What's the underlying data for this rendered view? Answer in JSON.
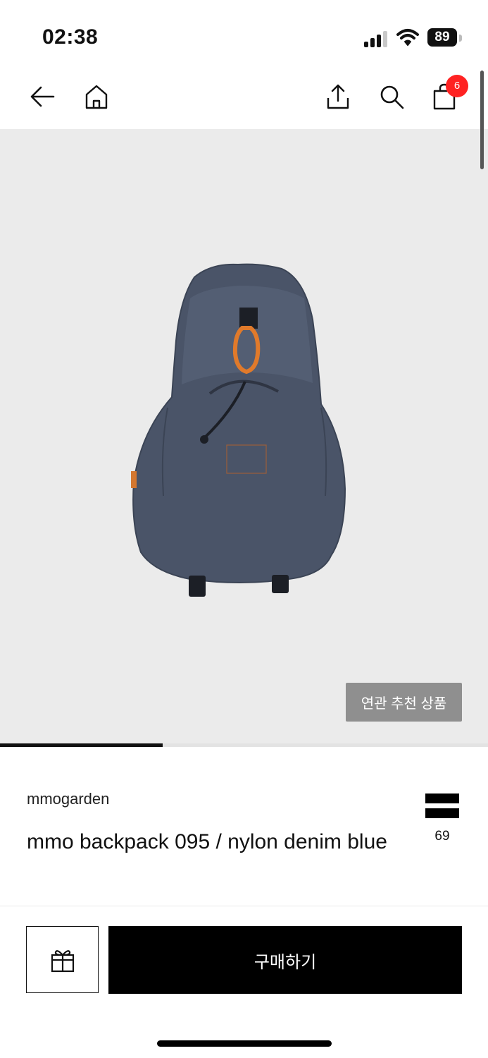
{
  "status_bar": {
    "time": "02:38",
    "battery": "89"
  },
  "nav": {
    "cart_count": "6"
  },
  "hero": {
    "related_label": "연관 추천 상품",
    "carousel_progress": 0.333
  },
  "product": {
    "brand": "mmogarden",
    "title": "mmo backpack 095 / nylon denim blue",
    "likes": "69"
  },
  "actions": {
    "buy_label": "구매하기"
  },
  "colors": {
    "accent": "#000000",
    "badge": "#ff2222",
    "hero_bg": "#ebebeb",
    "product": "#4a5468"
  }
}
